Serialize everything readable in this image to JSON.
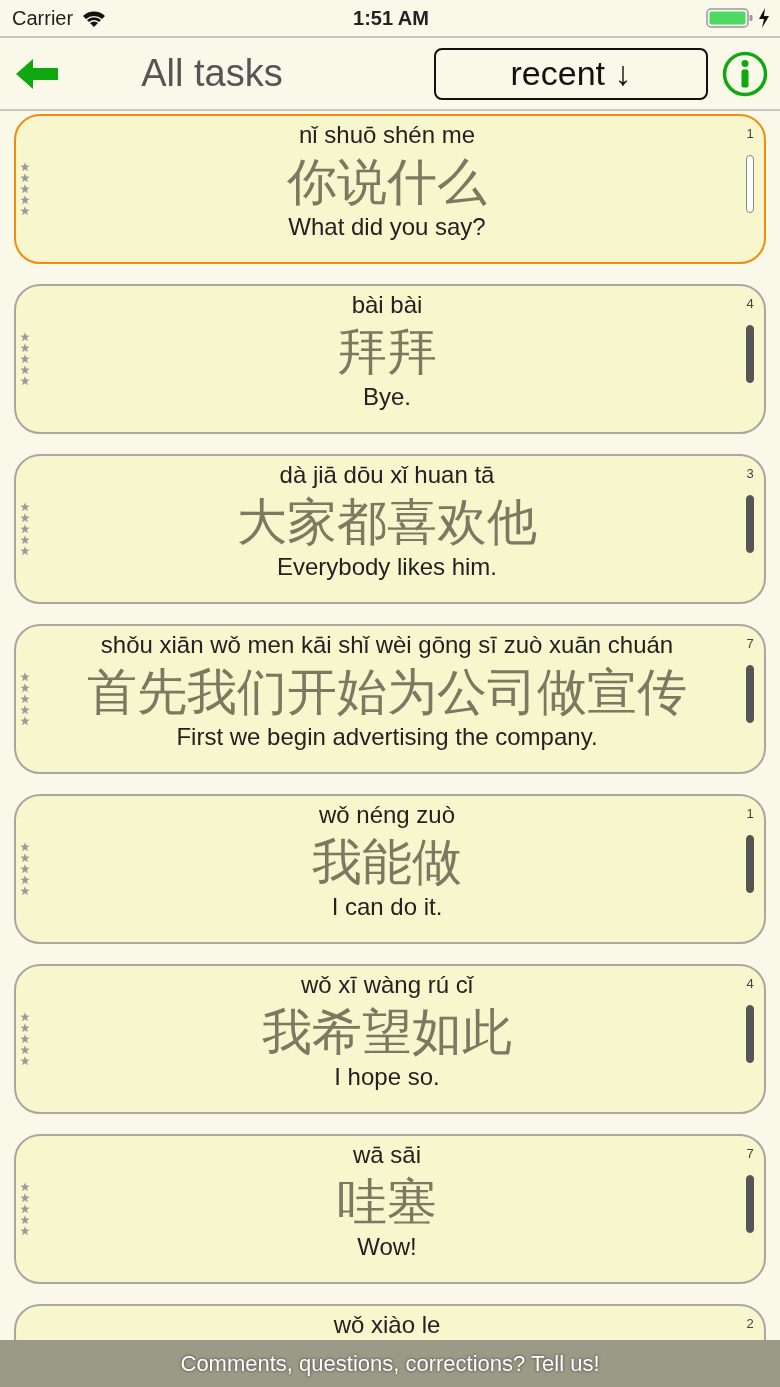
{
  "status_bar": {
    "carrier": "Carrier",
    "time": "1:51 AM"
  },
  "header": {
    "title": "All tasks",
    "sort_button": "recent ↓"
  },
  "cards": [
    {
      "pinyin": "nǐ shuō shén me",
      "hanzi": "你说什么",
      "english": "What did you say?",
      "count": "1",
      "bar_filled": false,
      "selected": true
    },
    {
      "pinyin": "bài bài",
      "hanzi": "拜拜",
      "english": "Bye.",
      "count": "4",
      "bar_filled": true,
      "selected": false
    },
    {
      "pinyin": "dà jiā dōu xǐ huan tā",
      "hanzi": "大家都喜欢他",
      "english": "Everybody likes him.",
      "count": "3",
      "bar_filled": true,
      "selected": false
    },
    {
      "pinyin": "shǒu xiān wǒ men kāi shǐ wèi gōng sī zuò xuān chuán",
      "hanzi": "首先我们开始为公司做宣传",
      "english": "First we begin advertising the company.",
      "count": "7",
      "bar_filled": true,
      "selected": false
    },
    {
      "pinyin": "wǒ néng zuò",
      "hanzi": "我能做",
      "english": "I can do it.",
      "count": "1",
      "bar_filled": true,
      "selected": false
    },
    {
      "pinyin": "wǒ xī wàng rú cǐ",
      "hanzi": "我希望如此",
      "english": "I hope so.",
      "count": "4",
      "bar_filled": true,
      "selected": false
    },
    {
      "pinyin": "wā sāi",
      "hanzi": "哇塞",
      "english": "Wow!",
      "count": "7",
      "bar_filled": true,
      "selected": false
    },
    {
      "pinyin": "wǒ xiào le",
      "count": "2",
      "selected": false
    }
  ],
  "feedback_banner": "Comments, questions, corrections? Tell us!"
}
